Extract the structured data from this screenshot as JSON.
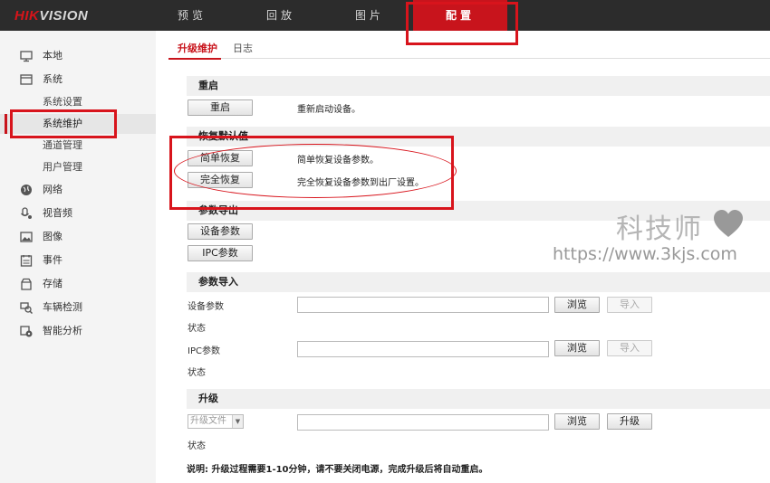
{
  "brand": {
    "logo_red": "HIK",
    "logo_rest": "VISION"
  },
  "nav": {
    "items": [
      {
        "label": "预览"
      },
      {
        "label": "回放"
      },
      {
        "label": "图片"
      },
      {
        "label": "配置"
      }
    ]
  },
  "sidebar": {
    "items": [
      {
        "label": "本地",
        "icon": "monitor-icon"
      },
      {
        "label": "系统",
        "icon": "window-icon"
      },
      {
        "label": "系统设置"
      },
      {
        "label": "系统维护"
      },
      {
        "label": "通道管理"
      },
      {
        "label": "用户管理"
      },
      {
        "label": "网络",
        "icon": "globe-icon"
      },
      {
        "label": "视音频",
        "icon": "microphone-icon"
      },
      {
        "label": "图像",
        "icon": "image-icon"
      },
      {
        "label": "事件",
        "icon": "calendar-icon"
      },
      {
        "label": "存储",
        "icon": "storage-icon"
      },
      {
        "label": "车辆检测",
        "icon": "vehicle-search-icon"
      },
      {
        "label": "智能分析",
        "icon": "smart-analysis-icon"
      }
    ]
  },
  "tabs": [
    {
      "label": "升级维护"
    },
    {
      "label": "日志"
    }
  ],
  "reboot": {
    "title": "重启",
    "button": "重启",
    "desc": "重新启动设备。"
  },
  "restore": {
    "title_visible": "恢复默认值",
    "simple_button": "简单恢复",
    "simple_desc": "简单恢复设备参数。",
    "full_button": "完全恢复",
    "full_desc": "完全恢复设备参数到出厂设置。"
  },
  "export": {
    "title": "参数导出",
    "device_button": "设备参数",
    "ipc_button": "IPC参数"
  },
  "import": {
    "title": "参数导入",
    "device_label": "设备参数",
    "status_label": "状态",
    "ipc_label": "IPC参数",
    "browse": "浏览",
    "import": "导入"
  },
  "upgrade": {
    "title": "升级",
    "file_select": "升级文件",
    "browse": "浏览",
    "upgrade": "升级",
    "status_label": "状态",
    "note": "说明: 升级过程需要1-10分钟，请不要关闭电源，完成升级后将自动重启。"
  },
  "watermark": {
    "title": "科技师",
    "url": "https://www.3kjs.com"
  },
  "colors": {
    "accent": "#c8141c",
    "topbar": "#2c2c2c",
    "annotation": "#d8141c"
  }
}
